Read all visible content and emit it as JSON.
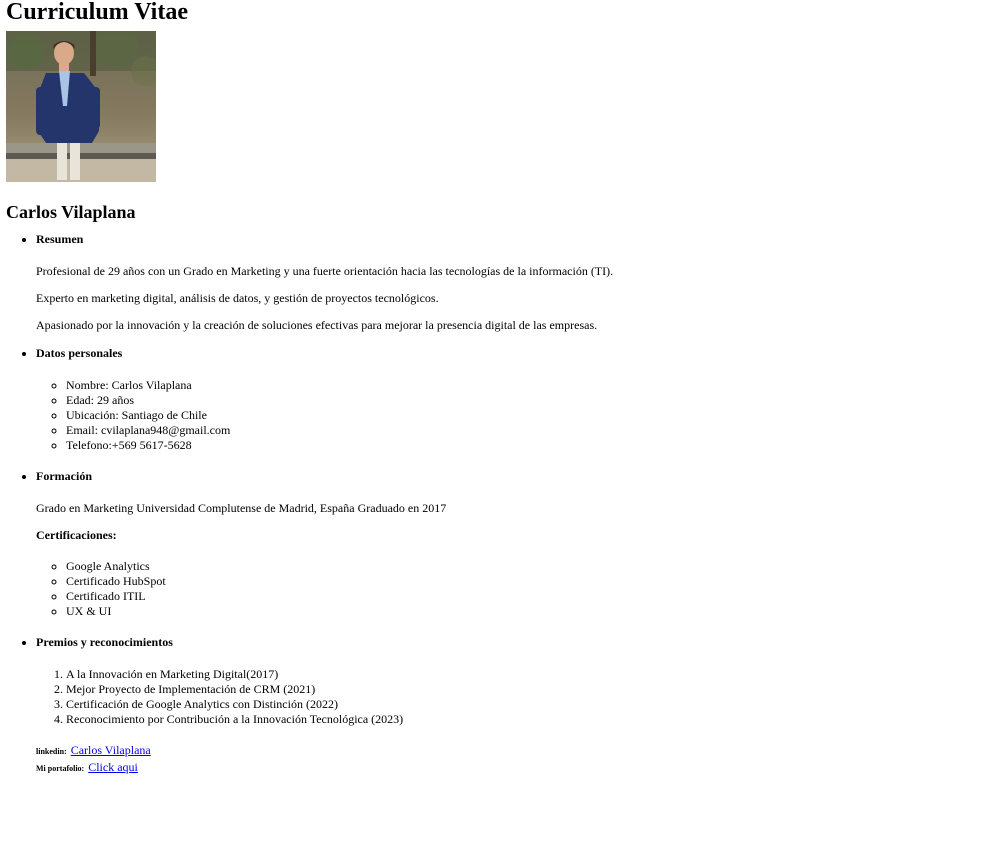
{
  "header": {
    "title": "Curriculum Vitae"
  },
  "profile": {
    "name": "Carlos Vilaplana",
    "photo_icon": "person-photo"
  },
  "resumen": {
    "title": "Resumen",
    "paragraphs": [
      "Profesional de 29 años con un Grado en Marketing y una fuerte orientación hacia las tecnologías de la información (TI).",
      "Experto en marketing digital, análisis de datos, y gestión de proyectos tecnológicos.",
      "Apasionado por la innovación y la creación de soluciones efectivas para mejorar la presencia digital de las empresas."
    ]
  },
  "datos": {
    "title": "Datos personales",
    "items": [
      "Nombre: Carlos Vilaplana",
      "Edad: 29 años",
      "Ubicación: Santiago de Chile",
      "Email: cvilaplana948@gmail.com",
      "Telefono:+569 5617-5628"
    ]
  },
  "formacion": {
    "title": "Formación",
    "degree": "Grado en Marketing Universidad Complutense de Madrid, España Graduado en 2017",
    "cert_title": "Certificaciones:",
    "certs": [
      "Google Analytics",
      "Certificado HubSpot",
      "Certificado ITIL",
      "UX & UI"
    ]
  },
  "premios": {
    "title": "Premios y reconocimientos",
    "items": [
      "A la Innovación en Marketing Digital(2017)",
      "Mejor Proyecto de Implementación de CRM (2021)",
      "Certificación de Google Analytics con Distinción (2022)",
      "Reconocimiento por Contribución a la Innovación Tecnológica (2023)"
    ]
  },
  "links": {
    "linkedin_label": "linkedin:",
    "linkedin_text": "Carlos Vilaplana",
    "portfolio_label": "Mi portafolio:",
    "portfolio_text": "Click aqui"
  }
}
